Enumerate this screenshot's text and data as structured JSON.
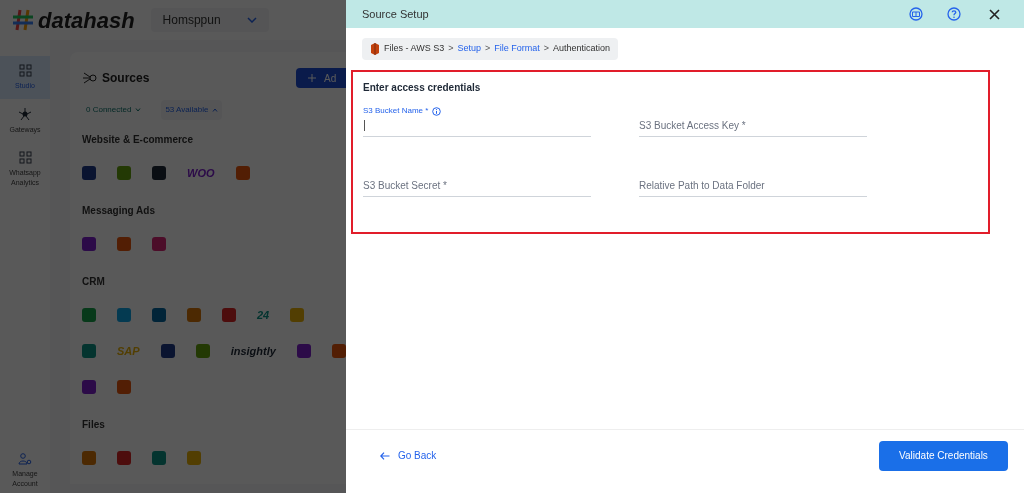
{
  "app": {
    "logo": "datahash",
    "workspace": "Homsppun",
    "nav": [
      {
        "label": "Studio",
        "selected": true,
        "kind": "grid"
      },
      {
        "label": "Gateways",
        "selected": false,
        "kind": "hub"
      },
      {
        "label": "Whatsapp Analytics",
        "selected": false,
        "kind": "grid"
      }
    ],
    "account": "Manage Account",
    "page_title": "Sources",
    "add_button": "Ad",
    "filters": [
      {
        "label": "0 Connected",
        "expanded": false
      },
      {
        "label": "53 Available",
        "expanded": true
      }
    ],
    "categories": [
      {
        "title": "Website & E-commerce",
        "rows": [
          [
            {
              "kind": "icon"
            },
            {
              "kind": "icon"
            },
            {
              "kind": "icon"
            },
            {
              "kind": "wordmark",
              "text": "WOO"
            },
            {
              "kind": "icon"
            }
          ]
        ]
      },
      {
        "title": "Messaging Ads",
        "rows": [
          [
            {
              "kind": "icon"
            },
            {
              "kind": "icon"
            },
            {
              "kind": "icon"
            }
          ]
        ]
      },
      {
        "title": "CRM",
        "rows": [
          [
            {
              "kind": "icon"
            },
            {
              "kind": "icon"
            },
            {
              "kind": "icon"
            },
            {
              "kind": "icon"
            },
            {
              "kind": "icon"
            },
            {
              "kind": "wordmark",
              "text": "24"
            },
            {
              "kind": "icon"
            }
          ],
          [
            {
              "kind": "icon"
            },
            {
              "kind": "wordmark",
              "text": "SAP"
            },
            {
              "kind": "icon"
            },
            {
              "kind": "icon"
            },
            {
              "kind": "wordmark",
              "text": "insightly"
            },
            {
              "kind": "icon"
            },
            {
              "kind": "icon"
            }
          ],
          [
            {
              "kind": "icon"
            },
            {
              "kind": "icon"
            }
          ]
        ]
      },
      {
        "title": "Files",
        "rows": [
          [
            {
              "kind": "icon"
            },
            {
              "kind": "icon"
            },
            {
              "kind": "icon"
            },
            {
              "kind": "icon"
            }
          ]
        ]
      }
    ]
  },
  "panel": {
    "title": "Source Setup",
    "breadcrumb": [
      {
        "label": "Files - AWS S3",
        "link": false,
        "separator": ">"
      },
      {
        "label": "Setup",
        "link": true,
        "separator": ">"
      },
      {
        "label": "File Format",
        "link": true,
        "separator": ">"
      },
      {
        "label": "Authentication",
        "link": false
      }
    ],
    "section_title": "Enter access credentials",
    "fields": [
      {
        "label": "S3 Bucket Name *",
        "focused": true,
        "info": true
      },
      {
        "placeholder": "S3 Bucket Access Key *",
        "focused": false,
        "info": false
      },
      {
        "placeholder": "S3 Bucket Secret *",
        "focused": false,
        "info": false
      },
      {
        "placeholder": "Relative Path to Data Folder",
        "focused": false,
        "info": false
      }
    ],
    "back": "Go Back",
    "submit": "Validate Credentials"
  }
}
